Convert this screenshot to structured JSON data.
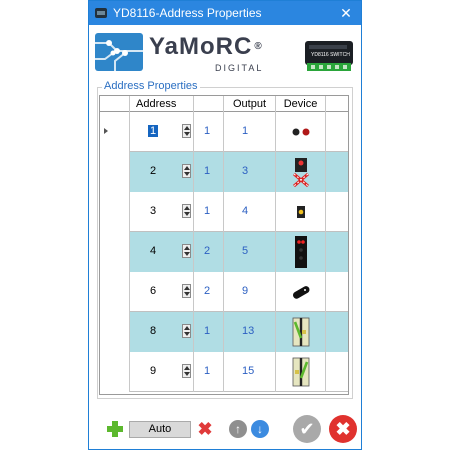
{
  "window": {
    "title": "YD8116-Address Properties",
    "close_label": "✕"
  },
  "banner": {
    "brand": "YaMoRC",
    "reg": "®",
    "sub": "DIGITAL",
    "device_label": "YD8116 SWITCH"
  },
  "group": {
    "label": "Address Properties"
  },
  "columns": {
    "address": "Address",
    "output": "Output",
    "device": "Device"
  },
  "rows": [
    {
      "address": "1",
      "mid": "1",
      "output": "1",
      "device": "double-led-icon",
      "alt": false,
      "selected": true
    },
    {
      "address": "2",
      "mid": "1",
      "output": "3",
      "device": "signal-cross-icon",
      "alt": true,
      "selected": false
    },
    {
      "address": "3",
      "mid": "1",
      "output": "4",
      "device": "yellow-signal-icon",
      "alt": false,
      "selected": false
    },
    {
      "address": "4",
      "mid": "2",
      "output": "5",
      "device": "red-signal-icon",
      "alt": true,
      "selected": false
    },
    {
      "address": "6",
      "mid": "2",
      "output": "9",
      "device": "uncoupler-icon",
      "alt": false,
      "selected": false
    },
    {
      "address": "8",
      "mid": "1",
      "output": "13",
      "device": "turnout-left-icon",
      "alt": true,
      "selected": false
    },
    {
      "address": "9",
      "mid": "1",
      "output": "15",
      "device": "turnout-right-icon",
      "alt": false,
      "selected": false
    }
  ],
  "toolbar": {
    "auto_label": "Auto",
    "up": "↑",
    "down": "↓",
    "ok": "✔",
    "cancel": "✖",
    "delete": "✖"
  },
  "colors": {
    "titlebar": "#2b86e0",
    "row_alt": "#b0dde4",
    "value_blue": "#2b5fc2",
    "accent_green": "#5cb82e",
    "accent_red": "#e03a3a"
  }
}
